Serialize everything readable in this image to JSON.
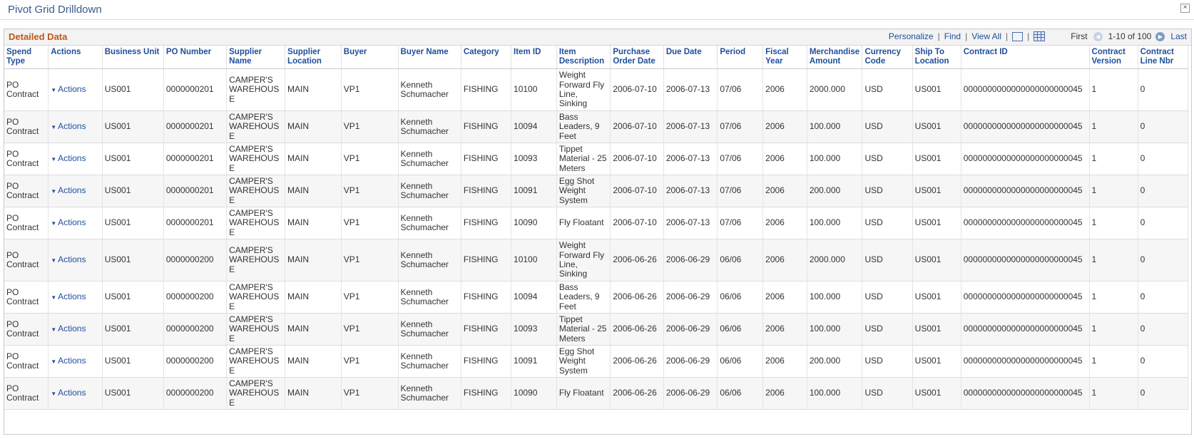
{
  "window": {
    "title": "Pivot Grid Drilldown",
    "close_glyph": "×"
  },
  "grid": {
    "title": "Detailed Data",
    "nav": {
      "personalize": "Personalize",
      "find": "Find",
      "view_all": "View All",
      "sep": "|",
      "first": "First",
      "range": "1-10 of 100",
      "last": "Last"
    },
    "columns": [
      "Spend Type",
      "Actions",
      "Business Unit",
      "PO Number",
      "Supplier Name",
      "Supplier Location",
      "Buyer",
      "Buyer Name",
      "Category",
      "Item ID",
      "Item Description",
      "Purchase Order Date",
      "Due Date",
      "Period",
      "Fiscal Year",
      "Merchandise Amount",
      "Currency Code",
      "Ship To Location",
      "Contract ID",
      "Contract Version",
      "Contract Line Nbr"
    ],
    "rows": [
      {
        "spend_type": "PO Contract",
        "actions": "Actions",
        "business_unit": "US001",
        "po_number": "0000000201",
        "supplier_name": "CAMPER'S WAREHOUS E",
        "supplier_location": "MAIN",
        "buyer": "VP1",
        "buyer_name": "Kenneth Schumacher",
        "category": "FISHING",
        "item_id": "10100",
        "item_description": "Weight Forward Fly Line, Sinking",
        "po_date": "2006-07-10",
        "due_date": "2006-07-13",
        "period": "07/06",
        "fiscal_year": "2006",
        "merch_amount": "2000.000",
        "currency": "USD",
        "ship_to": "US001",
        "contract_id": "0000000000000000000000045",
        "contract_version": "1",
        "contract_line": "0"
      },
      {
        "spend_type": "PO Contract",
        "actions": "Actions",
        "business_unit": "US001",
        "po_number": "0000000201",
        "supplier_name": "CAMPER'S WAREHOUS E",
        "supplier_location": "MAIN",
        "buyer": "VP1",
        "buyer_name": "Kenneth Schumacher",
        "category": "FISHING",
        "item_id": "10094",
        "item_description": "Bass Leaders, 9 Feet",
        "po_date": "2006-07-10",
        "due_date": "2006-07-13",
        "period": "07/06",
        "fiscal_year": "2006",
        "merch_amount": "100.000",
        "currency": "USD",
        "ship_to": "US001",
        "contract_id": "0000000000000000000000045",
        "contract_version": "1",
        "contract_line": "0"
      },
      {
        "spend_type": "PO Contract",
        "actions": "Actions",
        "business_unit": "US001",
        "po_number": "0000000201",
        "supplier_name": "CAMPER'S WAREHOUS E",
        "supplier_location": "MAIN",
        "buyer": "VP1",
        "buyer_name": "Kenneth Schumacher",
        "category": "FISHING",
        "item_id": "10093",
        "item_description": "Tippet Material - 25 Meters",
        "po_date": "2006-07-10",
        "due_date": "2006-07-13",
        "period": "07/06",
        "fiscal_year": "2006",
        "merch_amount": "100.000",
        "currency": "USD",
        "ship_to": "US001",
        "contract_id": "0000000000000000000000045",
        "contract_version": "1",
        "contract_line": "0"
      },
      {
        "spend_type": "PO Contract",
        "actions": "Actions",
        "business_unit": "US001",
        "po_number": "0000000201",
        "supplier_name": "CAMPER'S WAREHOUS E",
        "supplier_location": "MAIN",
        "buyer": "VP1",
        "buyer_name": "Kenneth Schumacher",
        "category": "FISHING",
        "item_id": "10091",
        "item_description": "Egg Shot Weight System",
        "po_date": "2006-07-10",
        "due_date": "2006-07-13",
        "period": "07/06",
        "fiscal_year": "2006",
        "merch_amount": "200.000",
        "currency": "USD",
        "ship_to": "US001",
        "contract_id": "0000000000000000000000045",
        "contract_version": "1",
        "contract_line": "0"
      },
      {
        "spend_type": "PO Contract",
        "actions": "Actions",
        "business_unit": "US001",
        "po_number": "0000000201",
        "supplier_name": "CAMPER'S WAREHOUS E",
        "supplier_location": "MAIN",
        "buyer": "VP1",
        "buyer_name": "Kenneth Schumacher",
        "category": "FISHING",
        "item_id": "10090",
        "item_description": "Fly Floatant",
        "po_date": "2006-07-10",
        "due_date": "2006-07-13",
        "period": "07/06",
        "fiscal_year": "2006",
        "merch_amount": "100.000",
        "currency": "USD",
        "ship_to": "US001",
        "contract_id": "0000000000000000000000045",
        "contract_version": "1",
        "contract_line": "0"
      },
      {
        "spend_type": "PO Contract",
        "actions": "Actions",
        "business_unit": "US001",
        "po_number": "0000000200",
        "supplier_name": "CAMPER'S WAREHOUS E",
        "supplier_location": "MAIN",
        "buyer": "VP1",
        "buyer_name": "Kenneth Schumacher",
        "category": "FISHING",
        "item_id": "10100",
        "item_description": "Weight Forward Fly Line, Sinking",
        "po_date": "2006-06-26",
        "due_date": "2006-06-29",
        "period": "06/06",
        "fiscal_year": "2006",
        "merch_amount": "2000.000",
        "currency": "USD",
        "ship_to": "US001",
        "contract_id": "0000000000000000000000045",
        "contract_version": "1",
        "contract_line": "0"
      },
      {
        "spend_type": "PO Contract",
        "actions": "Actions",
        "business_unit": "US001",
        "po_number": "0000000200",
        "supplier_name": "CAMPER'S WAREHOUS E",
        "supplier_location": "MAIN",
        "buyer": "VP1",
        "buyer_name": "Kenneth Schumacher",
        "category": "FISHING",
        "item_id": "10094",
        "item_description": "Bass Leaders, 9 Feet",
        "po_date": "2006-06-26",
        "due_date": "2006-06-29",
        "period": "06/06",
        "fiscal_year": "2006",
        "merch_amount": "100.000",
        "currency": "USD",
        "ship_to": "US001",
        "contract_id": "0000000000000000000000045",
        "contract_version": "1",
        "contract_line": "0"
      },
      {
        "spend_type": "PO Contract",
        "actions": "Actions",
        "business_unit": "US001",
        "po_number": "0000000200",
        "supplier_name": "CAMPER'S WAREHOUS E",
        "supplier_location": "MAIN",
        "buyer": "VP1",
        "buyer_name": "Kenneth Schumacher",
        "category": "FISHING",
        "item_id": "10093",
        "item_description": "Tippet Material - 25 Meters",
        "po_date": "2006-06-26",
        "due_date": "2006-06-29",
        "period": "06/06",
        "fiscal_year": "2006",
        "merch_amount": "100.000",
        "currency": "USD",
        "ship_to": "US001",
        "contract_id": "0000000000000000000000045",
        "contract_version": "1",
        "contract_line": "0"
      },
      {
        "spend_type": "PO Contract",
        "actions": "Actions",
        "business_unit": "US001",
        "po_number": "0000000200",
        "supplier_name": "CAMPER'S WAREHOUS E",
        "supplier_location": "MAIN",
        "buyer": "VP1",
        "buyer_name": "Kenneth Schumacher",
        "category": "FISHING",
        "item_id": "10091",
        "item_description": "Egg Shot Weight System",
        "po_date": "2006-06-26",
        "due_date": "2006-06-29",
        "period": "06/06",
        "fiscal_year": "2006",
        "merch_amount": "200.000",
        "currency": "USD",
        "ship_to": "US001",
        "contract_id": "0000000000000000000000045",
        "contract_version": "1",
        "contract_line": "0"
      },
      {
        "spend_type": "PO Contract",
        "actions": "Actions",
        "business_unit": "US001",
        "po_number": "0000000200",
        "supplier_name": "CAMPER'S WAREHOUS E",
        "supplier_location": "MAIN",
        "buyer": "VP1",
        "buyer_name": "Kenneth Schumacher",
        "category": "FISHING",
        "item_id": "10090",
        "item_description": "Fly Floatant",
        "po_date": "2006-06-26",
        "due_date": "2006-06-29",
        "period": "06/06",
        "fiscal_year": "2006",
        "merch_amount": "100.000",
        "currency": "USD",
        "ship_to": "US001",
        "contract_id": "0000000000000000000000045",
        "contract_version": "1",
        "contract_line": "0"
      }
    ]
  }
}
